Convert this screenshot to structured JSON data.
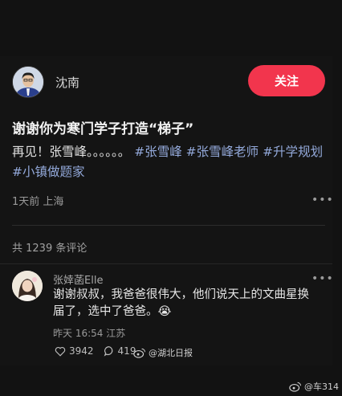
{
  "post": {
    "author": "沈南",
    "follow_label": "关注",
    "title": "谢谢你为寒门学子打造“梯子”",
    "text_prefix": "再见！张雪峰。。。。。。",
    "tags": [
      "#张雪峰",
      "#张雪峰老师",
      "#升学规划",
      "#小镇做题家"
    ],
    "meta": "1天前 上海"
  },
  "comments": {
    "count_label": "共 1239 条评论",
    "items": [
      {
        "user": "张婞菡Elle",
        "text": "谢谢叔叔，我爸爸很伟大，他们说天上的文曲星换届了，选中了爸爸。😭",
        "time": "昨天 16:54 江苏",
        "likes": "3942",
        "replies": "419"
      }
    ]
  },
  "watermarks": {
    "primary": "@湖北日报",
    "secondary": "@车314"
  },
  "icons": [
    "more-dots-icon",
    "heart-icon",
    "comment-bubble-icon",
    "weibo-icon"
  ],
  "colors": {
    "accent": "#f2354d",
    "tag": "#93a9da",
    "background": "#121212"
  }
}
